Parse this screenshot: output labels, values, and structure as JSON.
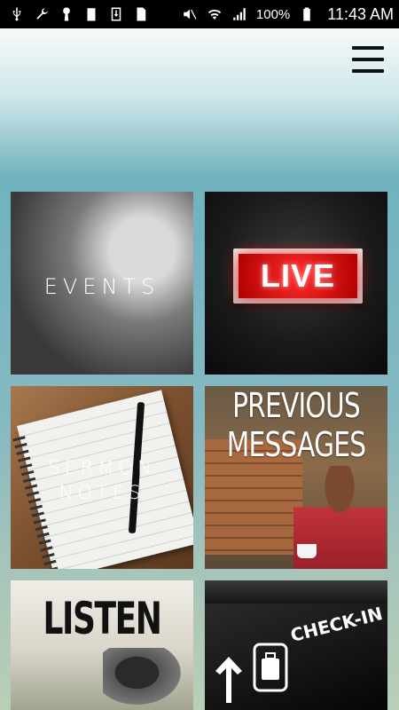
{
  "status_bar": {
    "icons": [
      "usb-icon",
      "wrench-icon",
      "keyhole-icon",
      "battery-100-icon",
      "download-icon",
      "sim-card-icon",
      "mute-icon",
      "wifi-icon",
      "signal-icon",
      "battery-icon"
    ],
    "battery_level": "100%",
    "time": "11:43 AM"
  },
  "header": {
    "menu_icon": "hamburger-menu-icon"
  },
  "tiles": [
    {
      "label": "EVENTS"
    },
    {
      "label": "LIVE"
    },
    {
      "label_line1": "SERMON",
      "label_line2": "NOTES"
    },
    {
      "label_line1": "PREVIOUS",
      "label_line2": "MESSAGES"
    },
    {
      "label": "LISTEN"
    },
    {
      "label": "CHECK-IN"
    }
  ]
}
